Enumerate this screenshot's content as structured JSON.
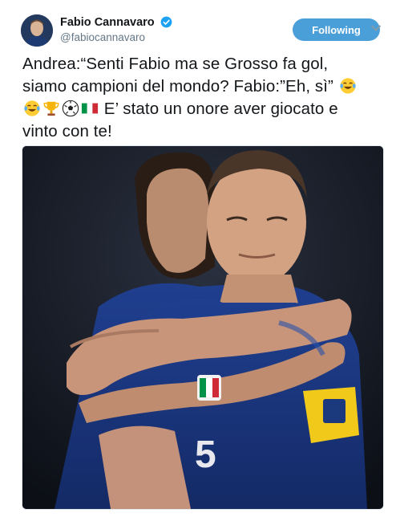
{
  "user": {
    "display_name": "Fabio Cannavaro",
    "handle": "@fabiocannavaro",
    "verified": true,
    "follow_label": "Following"
  },
  "tweet": {
    "line1": "Andrea:“Senti Fabio ma se Grosso fa gol,",
    "line2": "siamo campioni del mondo? Fabio:”Eh, sì”",
    "line3": "E’ stato un onore aver giocato e",
    "line4": "vinto con te!",
    "emojis": [
      "face-with-tears-of-joy",
      "face-with-tears-of-joy",
      "trophy",
      "soccer-ball",
      "italy-flag"
    ]
  },
  "colors": {
    "accent": "#4a9fd8",
    "verified": "#1da1f2",
    "handle": "#657786"
  }
}
